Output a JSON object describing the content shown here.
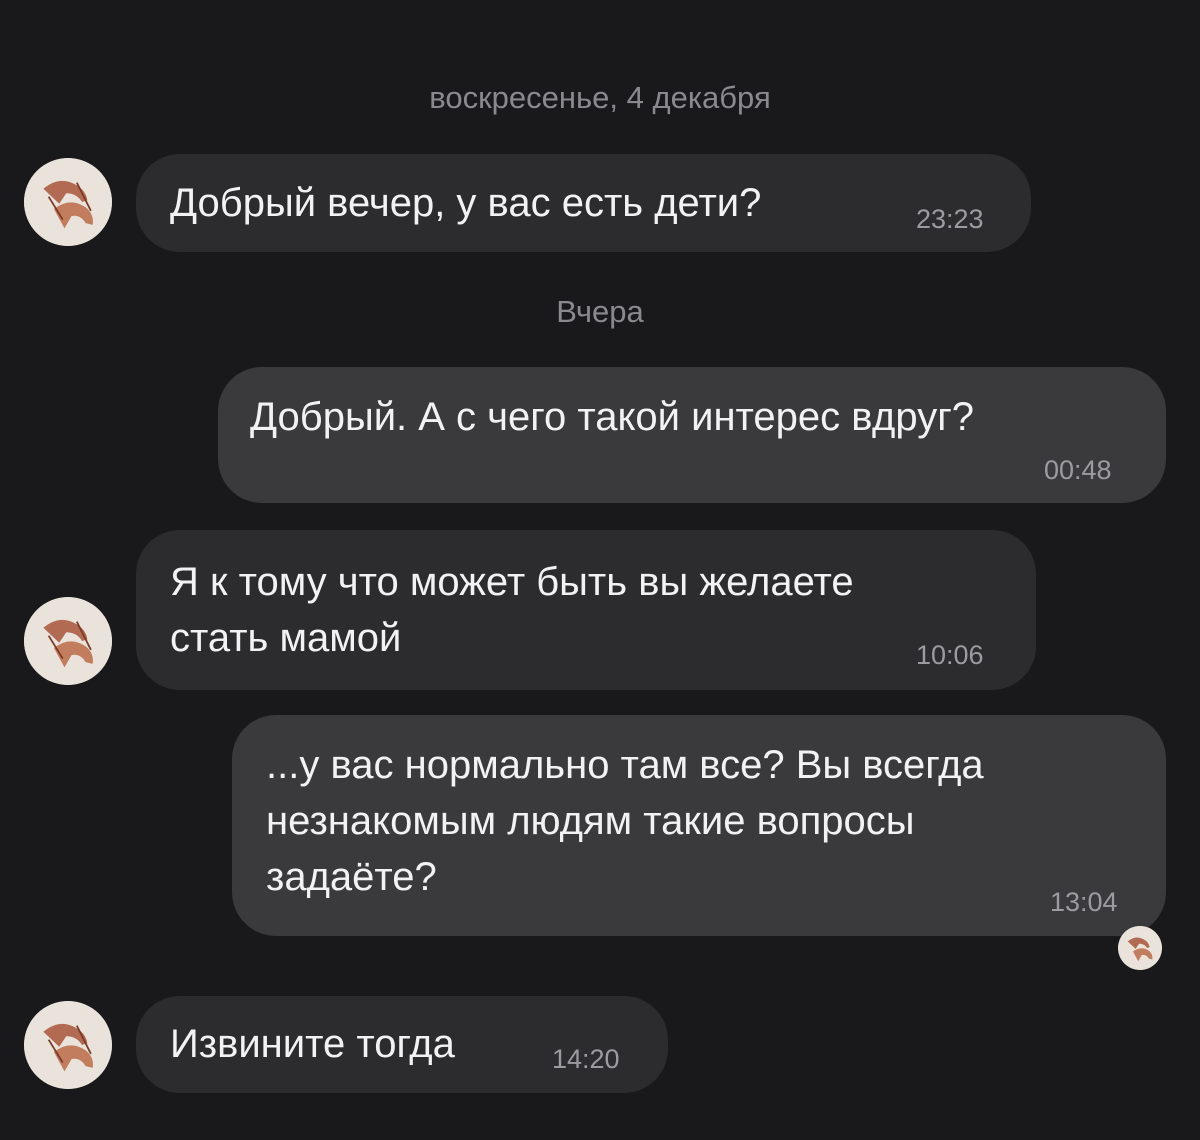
{
  "separators": {
    "sunday": "воскресенье, 4 декабря",
    "yesterday": "Вчера"
  },
  "messages": [
    {
      "direction": "incoming",
      "text": "Добрый вечер, у вас есть дети?",
      "time": "23:23"
    },
    {
      "direction": "outgoing",
      "text": "Добрый. А с чего такой интерес вдруг?",
      "time": "00:48"
    },
    {
      "direction": "incoming",
      "text": "Я к тому что может быть вы желаете\nстать мамой",
      "time": "10:06"
    },
    {
      "direction": "outgoing",
      "text": "...у вас нормально там все? Вы всегда\nнезнакомым людям такие вопросы\nзадаёте?",
      "time": "13:04",
      "read_receipt_avatar": true
    },
    {
      "direction": "incoming",
      "text": "Извините тогда",
      "time": "14:20"
    }
  ],
  "avatar_icon": "hands-sketch-icon",
  "colors": {
    "background": "#19191b",
    "incoming_bubble": "#2c2c2e",
    "outgoing_bubble": "#3a3a3c",
    "secondary_text": "#8a8a8e",
    "avatar_background": "#e9e3dc",
    "avatar_sketch": "#a8553a"
  }
}
